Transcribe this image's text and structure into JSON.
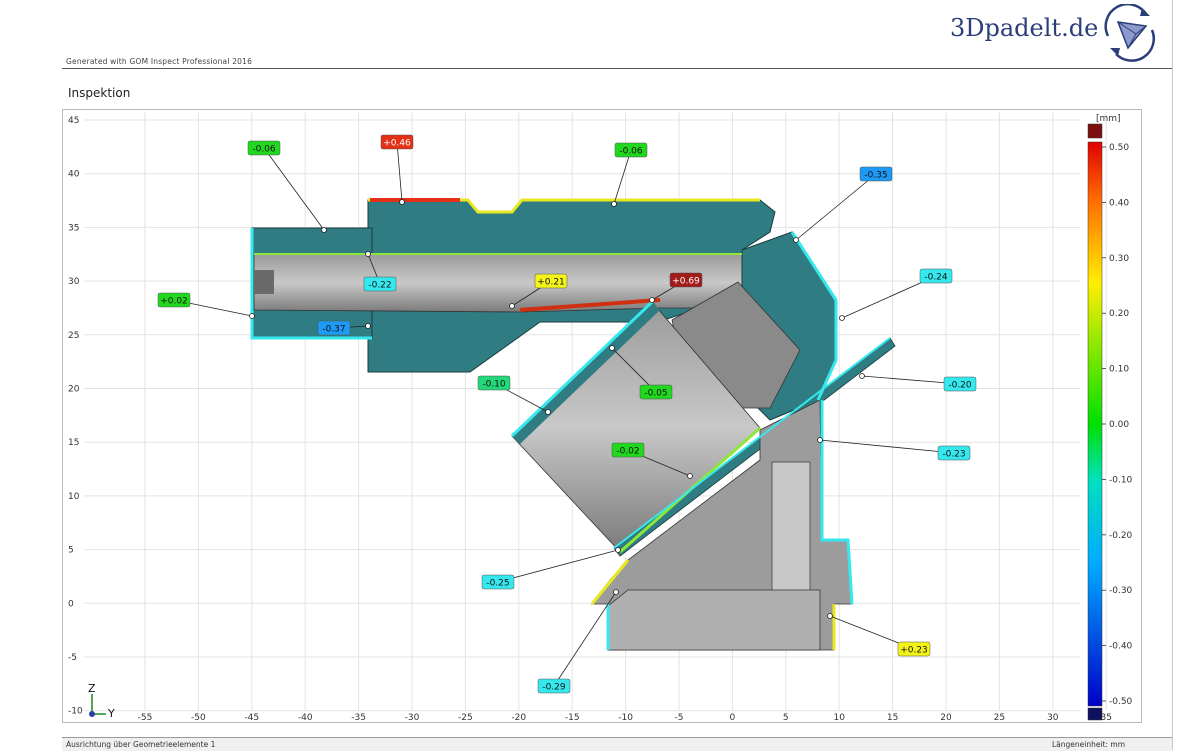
{
  "header": {
    "brand": "3Dpadelt.de",
    "generated": "Generated with GOM Inspect Professional 2016"
  },
  "section": {
    "title": "Inspektion"
  },
  "plot": {
    "x_ticks": [
      "-55",
      "-50",
      "-45",
      "-40",
      "-35",
      "-30",
      "-25",
      "-20",
      "-15",
      "-10",
      "-5",
      "0",
      "5",
      "10",
      "15",
      "20",
      "25",
      "30",
      "35"
    ],
    "y_ticks": [
      "45",
      "40",
      "35",
      "30",
      "25",
      "20",
      "15",
      "10",
      "5",
      "0",
      "-5",
      "-10"
    ],
    "axis_z": "Z",
    "axis_y": "Y",
    "labels": [
      {
        "value": "-0.06",
        "color": "#22d81e"
      },
      {
        "value": "+0.46",
        "color": "#e43017"
      },
      {
        "value": "-0.06",
        "color": "#22d81e"
      },
      {
        "value": "-0.35",
        "color": "#1d9af5"
      },
      {
        "value": "-0.24",
        "color": "#35e8ee"
      },
      {
        "value": "+0.02",
        "color": "#22d81e"
      },
      {
        "value": "-0.22",
        "color": "#35e8ee"
      },
      {
        "value": "-0.37",
        "color": "#1d9af5"
      },
      {
        "value": "+0.21",
        "color": "#f4f418"
      },
      {
        "value": "+0.69",
        "color": "#a31b1b"
      },
      {
        "value": "-0.10",
        "color": "#22d878"
      },
      {
        "value": "-0.05",
        "color": "#22d81e"
      },
      {
        "value": "-0.20",
        "color": "#35e8ee"
      },
      {
        "value": "-0.02",
        "color": "#22d81e"
      },
      {
        "value": "-0.23",
        "color": "#35e8ee"
      },
      {
        "value": "-0.25",
        "color": "#35e8ee"
      },
      {
        "value": "-0.29",
        "color": "#35e8ee"
      },
      {
        "value": "+0.23",
        "color": "#f4f418"
      }
    ]
  },
  "legend": {
    "unit": "[mm]",
    "values": [
      "0.50",
      "0.40",
      "0.30",
      "0.20",
      "0.10",
      "0.00",
      "-0.10",
      "-0.20",
      "-0.30",
      "-0.40",
      "-0.50"
    ]
  },
  "footer": {
    "left": "Ausrichtung über Geometrieelemente 1",
    "right": "Längeneinheit: mm"
  }
}
